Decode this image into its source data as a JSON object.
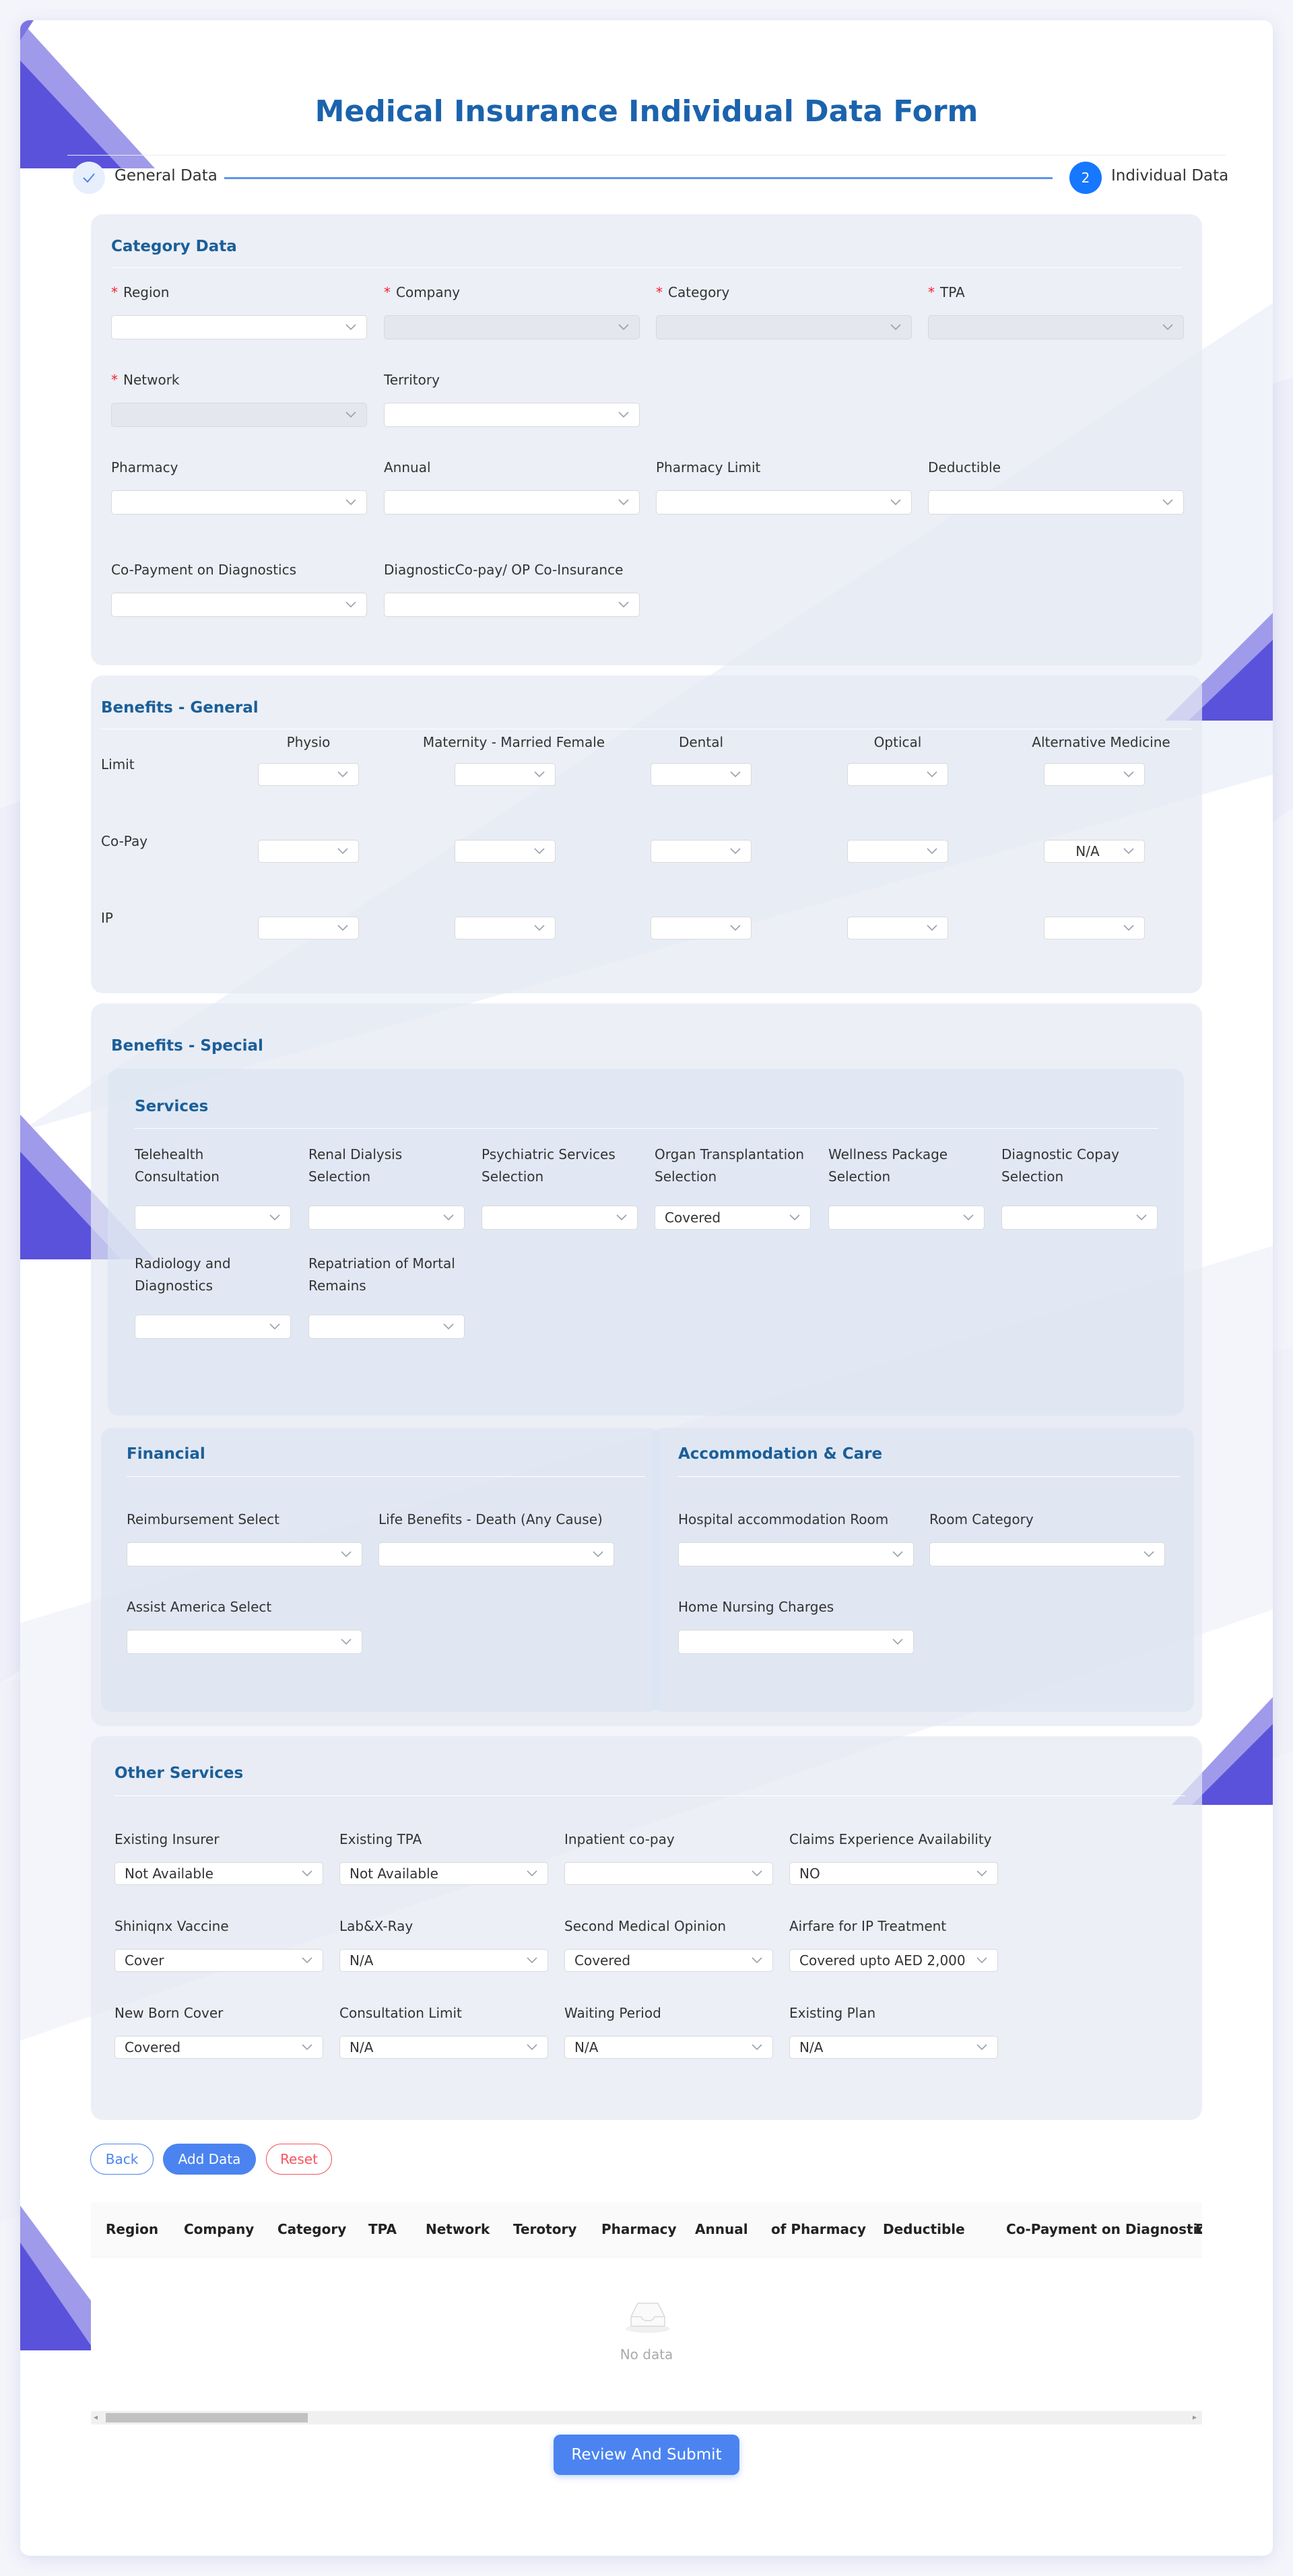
{
  "title": "Medical Insurance Individual Data Form",
  "steps": [
    {
      "label": "General Data",
      "state": "done"
    },
    {
      "number": "2",
      "label": "Individual Data",
      "state": "active"
    }
  ],
  "category": {
    "title": "Category Data",
    "region": {
      "label": "Region",
      "value": ""
    },
    "company": {
      "label": "Company",
      "value": ""
    },
    "category": {
      "label": "Category",
      "value": ""
    },
    "tpa": {
      "label": "TPA",
      "value": ""
    },
    "network": {
      "label": "Network",
      "value": ""
    },
    "territory": {
      "label": "Territory",
      "value": ""
    },
    "pharmacy": {
      "label": "Pharmacy",
      "value": ""
    },
    "annual": {
      "label": "Annual",
      "value": ""
    },
    "pharmacy_limit": {
      "label": "Pharmacy Limit",
      "value": ""
    },
    "deductible": {
      "label": "Deductible",
      "value": ""
    },
    "copay_diag": {
      "label": "Co-Payment on Diagnostics",
      "value": ""
    },
    "diag_copay": {
      "label": "DiagnosticCo-pay/ OP Co-Insurance",
      "value": ""
    }
  },
  "benefits_general": {
    "title": "Benefits - General",
    "columns": [
      "Physio",
      "Maternity - Married Female",
      "Dental",
      "Optical",
      "Alternative Medicine"
    ],
    "rows": [
      {
        "label": "Limit",
        "values": [
          "",
          "",
          "",
          "",
          ""
        ]
      },
      {
        "label": "Co-Pay",
        "values": [
          "",
          "",
          "",
          "",
          "N/A"
        ]
      },
      {
        "label": "IP",
        "values": [
          "",
          "",
          "",
          "",
          ""
        ]
      }
    ]
  },
  "benefits_special": {
    "title": "Benefits - Special",
    "services": {
      "title": "Services",
      "telehealth": {
        "label1": "Telehealth",
        "label2": "Consultation",
        "value": ""
      },
      "renal": {
        "label1": "Renal Dialysis",
        "label2": "Selection",
        "value": ""
      },
      "psychiatric": {
        "label1": "Psychiatric Services",
        "label2": "Selection",
        "value": ""
      },
      "organ": {
        "label1": "Organ Transplantation",
        "label2": "Selection",
        "value": "Covered"
      },
      "wellness": {
        "label1": "Wellness Package",
        "label2": "Selection",
        "value": ""
      },
      "diag_copay": {
        "label1": "Diagnostic Copay",
        "label2": "Selection",
        "value": ""
      },
      "radiology": {
        "label1": "Radiology and",
        "label2": "Diagnostics",
        "value": ""
      },
      "repatriation": {
        "label1": "Repatriation of Mortal",
        "label2": "Remains",
        "value": ""
      }
    },
    "financial": {
      "title": "Financial",
      "reimbursement": {
        "label": "Reimbursement Select",
        "value": ""
      },
      "life_benefits": {
        "label": "Life Benefits - Death (Any Cause)",
        "value": ""
      },
      "assist_america": {
        "label": "Assist America Select",
        "value": ""
      }
    },
    "accommodation": {
      "title": "Accommodation & Care",
      "hospital_room": {
        "label": "Hospital accommodation Room",
        "value": ""
      },
      "room_category": {
        "label": "Room Category",
        "value": ""
      },
      "home_nursing": {
        "label": "Home Nursing Charges",
        "value": ""
      }
    }
  },
  "other_services": {
    "title": "Other Services",
    "existing_insurer": {
      "label": "Existing Insurer",
      "value": "Not Available"
    },
    "existing_tpa": {
      "label": "Existing TPA",
      "value": "Not Available"
    },
    "inpatient_copay": {
      "label": "Inpatient co-pay",
      "value": ""
    },
    "claims_experience": {
      "label": "Claims Experience Availability",
      "value": "NO"
    },
    "shiniqnx": {
      "label": "Shiniqnx Vaccine",
      "value": "Cover"
    },
    "lab_xray": {
      "label": "Lab&X-Ray",
      "value": "N/A"
    },
    "second_opinion": {
      "label": "Second Medical Opinion",
      "value": "Covered"
    },
    "airfare": {
      "label": "Airfare for IP Treatment",
      "value": "Covered upto AED 2,000"
    },
    "new_born": {
      "label": "New Born Cover",
      "value": "Covered"
    },
    "consultation_limit": {
      "label": "Consultation Limit",
      "value": "N/A"
    },
    "waiting_period": {
      "label": "Waiting Period",
      "value": "N/A"
    },
    "existing_plan": {
      "label": "Existing Plan",
      "value": "N/A"
    }
  },
  "buttons": {
    "back": "Back",
    "add": "Add Data",
    "reset": "Reset",
    "submit": "Review And Submit"
  },
  "table": {
    "columns": [
      "Region",
      "Company",
      "Category",
      "TPA",
      "Network",
      "Terotory",
      "Pharmacy",
      "Annual",
      "of Pharmacy",
      "Deductible",
      "Co-Payment on Diagnostics",
      "D"
    ],
    "empty_text": "No data"
  },
  "colors": {
    "primary": "#4b84f0",
    "title": "#1b63ad",
    "section_title": "#1b5f98",
    "reset": "#f5555d",
    "required": "#f5222d",
    "deco": "#5a52db"
  }
}
